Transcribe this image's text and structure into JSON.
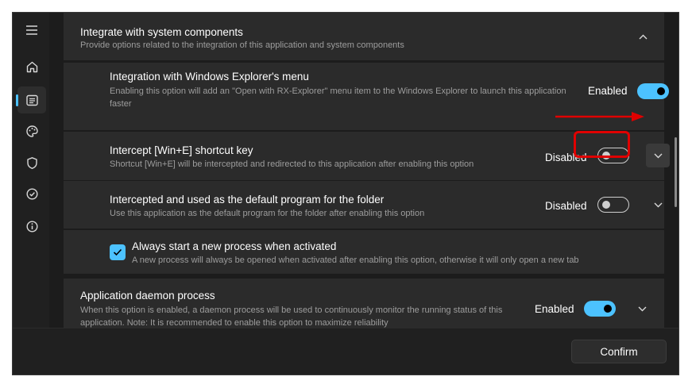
{
  "sidebar": {
    "items": [
      {
        "icon": "menu-icon"
      },
      {
        "icon": "home-icon"
      },
      {
        "icon": "settings-panel-icon",
        "active": true
      },
      {
        "icon": "palette-icon"
      },
      {
        "icon": "shield-icon"
      },
      {
        "icon": "check-circle-icon"
      },
      {
        "icon": "info-icon"
      }
    ]
  },
  "sections": {
    "integrate": {
      "title": "Integrate with system components",
      "description": "Provide options related to the integration of this application and system components"
    },
    "explorer_menu": {
      "title": "Integration with Windows Explorer's menu",
      "description": "Enabling this option will add an \"Open with RX-Explorer\" menu item to the Windows Explorer to launch this application faster",
      "state": "Enabled",
      "on": true
    },
    "win_e": {
      "title": "Intercept [Win+E] shortcut key",
      "description": "Shortcut [Win+E] will be intercepted and redirected to this application after enabling this option",
      "state": "Disabled",
      "on": false
    },
    "default_folder": {
      "title": "Intercepted and used as the default program for the folder",
      "description": "Use this application as the default program for the folder after enabling this option",
      "state": "Disabled",
      "on": false
    },
    "new_process": {
      "title": "Always start a new process when activated",
      "description": "A new process will always be opened when activated after enabling this option, otherwise it will only open a new tab",
      "checked": true
    },
    "daemon": {
      "title": "Application daemon process",
      "description": "When this option is enabled, a daemon process will be used to continuously monitor the running status of this application. Note: It is recommended to enable this option to maximize reliability",
      "state": "Enabled",
      "on": true
    }
  },
  "footer": {
    "confirm_label": "Confirm"
  },
  "colors": {
    "accent": "#4cc2ff",
    "annotation": "#e00000"
  }
}
